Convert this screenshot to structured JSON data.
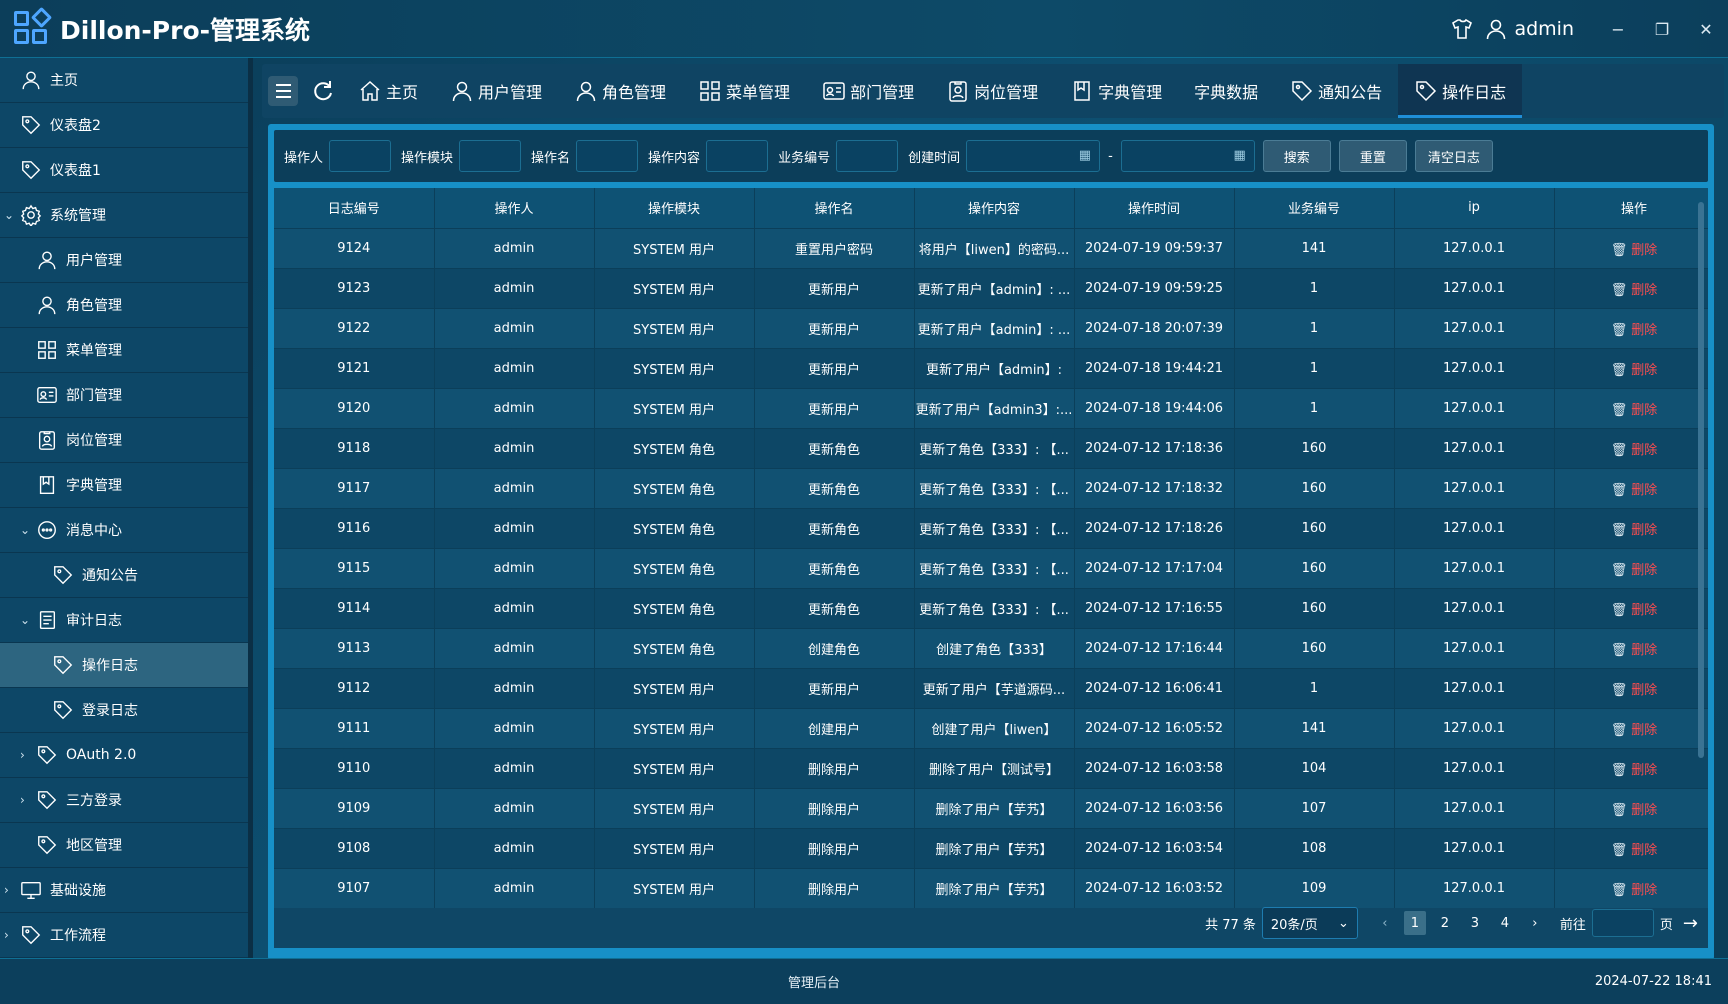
{
  "app": {
    "title": "Dillon-Pro-管理系统",
    "user": "admin"
  },
  "colors": {
    "header_bg": "#0c3e5a",
    "accent": "#1f8fd8",
    "danger": "#ff4d4f",
    "active_menu": "#2d6580"
  },
  "sidebar": {
    "items": [
      {
        "label": "主页",
        "icon": "user-icon",
        "level": 0
      },
      {
        "label": "仪表盘2",
        "icon": "tag-icon",
        "level": 0
      },
      {
        "label": "仪表盘1",
        "icon": "tag-icon",
        "level": 0
      },
      {
        "label": "系统管理",
        "icon": "gear-icon",
        "level": 0,
        "caret": "down"
      },
      {
        "label": "用户管理",
        "icon": "user-icon",
        "level": 1
      },
      {
        "label": "角色管理",
        "icon": "user-icon",
        "level": 1
      },
      {
        "label": "菜单管理",
        "icon": "grid-icon",
        "level": 1
      },
      {
        "label": "部门管理",
        "icon": "id-card-icon",
        "level": 1
      },
      {
        "label": "岗位管理",
        "icon": "badge-icon",
        "level": 1
      },
      {
        "label": "字典管理",
        "icon": "book-icon",
        "level": 1
      },
      {
        "label": "消息中心",
        "icon": "chat-icon",
        "level": 1,
        "caret": "down"
      },
      {
        "label": "通知公告",
        "icon": "tag-icon",
        "level": 2
      },
      {
        "label": "审计日志",
        "icon": "document-icon",
        "level": 1,
        "caret": "down"
      },
      {
        "label": "操作日志",
        "icon": "tag-icon",
        "level": 2,
        "active": true
      },
      {
        "label": "登录日志",
        "icon": "tag-icon",
        "level": 2
      },
      {
        "label": "OAuth 2.0",
        "icon": "tag-icon",
        "level": 1,
        "caret": "right"
      },
      {
        "label": "三方登录",
        "icon": "tag-icon",
        "level": 1,
        "caret": "right"
      },
      {
        "label": "地区管理",
        "icon": "tag-icon",
        "level": 1
      },
      {
        "label": "基础设施",
        "icon": "monitor-icon",
        "level": 0,
        "caret": "right"
      },
      {
        "label": "工作流程",
        "icon": "tag-icon",
        "level": 0,
        "caret": "right"
      }
    ]
  },
  "tabs": [
    {
      "label": "主页",
      "icon": "home-icon"
    },
    {
      "label": "用户管理",
      "icon": "user-icon"
    },
    {
      "label": "角色管理",
      "icon": "user-icon"
    },
    {
      "label": "菜单管理",
      "icon": "grid-icon"
    },
    {
      "label": "部门管理",
      "icon": "id-card-icon"
    },
    {
      "label": "岗位管理",
      "icon": "badge-icon"
    },
    {
      "label": "字典管理",
      "icon": "book-icon"
    },
    {
      "label": "字典数据",
      "icon": ""
    },
    {
      "label": "通知公告",
      "icon": "tag-icon"
    },
    {
      "label": "操作日志",
      "icon": "tag-icon",
      "active": true
    }
  ],
  "filters": {
    "operator": "操作人",
    "module": "操作模块",
    "name": "操作名",
    "content": "操作内容",
    "biz_no": "业务编号",
    "created": "创建时间",
    "date_sep": "-",
    "search": "搜索",
    "reset": "重置",
    "clear": "清空日志"
  },
  "table": {
    "columns": [
      "日志编号",
      "操作人",
      "操作模块",
      "操作名",
      "操作内容",
      "操作时间",
      "业务编号",
      "ip",
      "操作"
    ],
    "delete_label": "删除",
    "rows": [
      [
        "9124",
        "admin",
        "SYSTEM 用户",
        "重置用户密码",
        "将用户【liwen】的密码...",
        "2024-07-19 09:59:37",
        "141",
        "127.0.0.1"
      ],
      [
        "9123",
        "admin",
        "SYSTEM 用户",
        "更新用户",
        "更新了用户【admin】: ...",
        "2024-07-19 09:59:25",
        "1",
        "127.0.0.1"
      ],
      [
        "9122",
        "admin",
        "SYSTEM 用户",
        "更新用户",
        "更新了用户【admin】: ...",
        "2024-07-18 20:07:39",
        "1",
        "127.0.0.1"
      ],
      [
        "9121",
        "admin",
        "SYSTEM 用户",
        "更新用户",
        "更新了用户【admin】:",
        "2024-07-18 19:44:21",
        "1",
        "127.0.0.1"
      ],
      [
        "9120",
        "admin",
        "SYSTEM 用户",
        "更新用户",
        "更新了用户【admin3】:...",
        "2024-07-18 19:44:06",
        "1",
        "127.0.0.1"
      ],
      [
        "9118",
        "admin",
        "SYSTEM 角色",
        "更新角色",
        "更新了角色【333】: 【...",
        "2024-07-12 17:18:36",
        "160",
        "127.0.0.1"
      ],
      [
        "9117",
        "admin",
        "SYSTEM 角色",
        "更新角色",
        "更新了角色【333】: 【...",
        "2024-07-12 17:18:32",
        "160",
        "127.0.0.1"
      ],
      [
        "9116",
        "admin",
        "SYSTEM 角色",
        "更新角色",
        "更新了角色【333】: 【...",
        "2024-07-12 17:18:26",
        "160",
        "127.0.0.1"
      ],
      [
        "9115",
        "admin",
        "SYSTEM 角色",
        "更新角色",
        "更新了角色【333】: 【...",
        "2024-07-12 17:17:04",
        "160",
        "127.0.0.1"
      ],
      [
        "9114",
        "admin",
        "SYSTEM 角色",
        "更新角色",
        "更新了角色【333】: 【...",
        "2024-07-12 17:16:55",
        "160",
        "127.0.0.1"
      ],
      [
        "9113",
        "admin",
        "SYSTEM 角色",
        "创建角色",
        "创建了角色【333】",
        "2024-07-12 17:16:44",
        "160",
        "127.0.0.1"
      ],
      [
        "9112",
        "admin",
        "SYSTEM 用户",
        "更新用户",
        "更新了用户【芋道源码...",
        "2024-07-12 16:06:41",
        "1",
        "127.0.0.1"
      ],
      [
        "9111",
        "admin",
        "SYSTEM 用户",
        "创建用户",
        "创建了用户【liwen】",
        "2024-07-12 16:05:52",
        "141",
        "127.0.0.1"
      ],
      [
        "9110",
        "admin",
        "SYSTEM 用户",
        "删除用户",
        "删除了用户【测试号】",
        "2024-07-12 16:03:58",
        "104",
        "127.0.0.1"
      ],
      [
        "9109",
        "admin",
        "SYSTEM 用户",
        "删除用户",
        "删除了用户【芋艿】",
        "2024-07-12 16:03:56",
        "107",
        "127.0.0.1"
      ],
      [
        "9108",
        "admin",
        "SYSTEM 用户",
        "删除用户",
        "删除了用户【芋艿】",
        "2024-07-12 16:03:54",
        "108",
        "127.0.0.1"
      ],
      [
        "9107",
        "admin",
        "SYSTEM 用户",
        "删除用户",
        "删除了用户【芋艿】",
        "2024-07-12 16:03:52",
        "109",
        "127.0.0.1"
      ]
    ]
  },
  "pagination": {
    "total": "共 77 条",
    "page_size": "20条/页",
    "pages": [
      "1",
      "2",
      "3",
      "4"
    ],
    "current": "1",
    "goto_label": "前往",
    "page_unit": "页"
  },
  "footer": {
    "center": "管理后台",
    "time": "2024-07-22 18:41"
  }
}
